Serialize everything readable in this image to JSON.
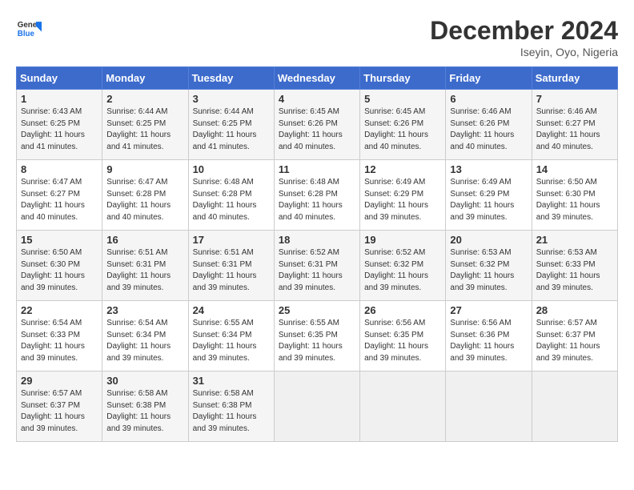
{
  "header": {
    "logo_line1": "General",
    "logo_line2": "Blue",
    "month_title": "December 2024",
    "location": "Iseyin, Oyo, Nigeria"
  },
  "days_of_week": [
    "Sunday",
    "Monday",
    "Tuesday",
    "Wednesday",
    "Thursday",
    "Friday",
    "Saturday"
  ],
  "weeks": [
    [
      {
        "day": "1",
        "sunrise": "6:43 AM",
        "sunset": "6:25 PM",
        "daylight": "11 hours and 41 minutes."
      },
      {
        "day": "2",
        "sunrise": "6:44 AM",
        "sunset": "6:25 PM",
        "daylight": "11 hours and 41 minutes."
      },
      {
        "day": "3",
        "sunrise": "6:44 AM",
        "sunset": "6:25 PM",
        "daylight": "11 hours and 41 minutes."
      },
      {
        "day": "4",
        "sunrise": "6:45 AM",
        "sunset": "6:26 PM",
        "daylight": "11 hours and 40 minutes."
      },
      {
        "day": "5",
        "sunrise": "6:45 AM",
        "sunset": "6:26 PM",
        "daylight": "11 hours and 40 minutes."
      },
      {
        "day": "6",
        "sunrise": "6:46 AM",
        "sunset": "6:26 PM",
        "daylight": "11 hours and 40 minutes."
      },
      {
        "day": "7",
        "sunrise": "6:46 AM",
        "sunset": "6:27 PM",
        "daylight": "11 hours and 40 minutes."
      }
    ],
    [
      {
        "day": "8",
        "sunrise": "6:47 AM",
        "sunset": "6:27 PM",
        "daylight": "11 hours and 40 minutes."
      },
      {
        "day": "9",
        "sunrise": "6:47 AM",
        "sunset": "6:28 PM",
        "daylight": "11 hours and 40 minutes."
      },
      {
        "day": "10",
        "sunrise": "6:48 AM",
        "sunset": "6:28 PM",
        "daylight": "11 hours and 40 minutes."
      },
      {
        "day": "11",
        "sunrise": "6:48 AM",
        "sunset": "6:28 PM",
        "daylight": "11 hours and 40 minutes."
      },
      {
        "day": "12",
        "sunrise": "6:49 AM",
        "sunset": "6:29 PM",
        "daylight": "11 hours and 39 minutes."
      },
      {
        "day": "13",
        "sunrise": "6:49 AM",
        "sunset": "6:29 PM",
        "daylight": "11 hours and 39 minutes."
      },
      {
        "day": "14",
        "sunrise": "6:50 AM",
        "sunset": "6:30 PM",
        "daylight": "11 hours and 39 minutes."
      }
    ],
    [
      {
        "day": "15",
        "sunrise": "6:50 AM",
        "sunset": "6:30 PM",
        "daylight": "11 hours and 39 minutes."
      },
      {
        "day": "16",
        "sunrise": "6:51 AM",
        "sunset": "6:31 PM",
        "daylight": "11 hours and 39 minutes."
      },
      {
        "day": "17",
        "sunrise": "6:51 AM",
        "sunset": "6:31 PM",
        "daylight": "11 hours and 39 minutes."
      },
      {
        "day": "18",
        "sunrise": "6:52 AM",
        "sunset": "6:31 PM",
        "daylight": "11 hours and 39 minutes."
      },
      {
        "day": "19",
        "sunrise": "6:52 AM",
        "sunset": "6:32 PM",
        "daylight": "11 hours and 39 minutes."
      },
      {
        "day": "20",
        "sunrise": "6:53 AM",
        "sunset": "6:32 PM",
        "daylight": "11 hours and 39 minutes."
      },
      {
        "day": "21",
        "sunrise": "6:53 AM",
        "sunset": "6:33 PM",
        "daylight": "11 hours and 39 minutes."
      }
    ],
    [
      {
        "day": "22",
        "sunrise": "6:54 AM",
        "sunset": "6:33 PM",
        "daylight": "11 hours and 39 minutes."
      },
      {
        "day": "23",
        "sunrise": "6:54 AM",
        "sunset": "6:34 PM",
        "daylight": "11 hours and 39 minutes."
      },
      {
        "day": "24",
        "sunrise": "6:55 AM",
        "sunset": "6:34 PM",
        "daylight": "11 hours and 39 minutes."
      },
      {
        "day": "25",
        "sunrise": "6:55 AM",
        "sunset": "6:35 PM",
        "daylight": "11 hours and 39 minutes."
      },
      {
        "day": "26",
        "sunrise": "6:56 AM",
        "sunset": "6:35 PM",
        "daylight": "11 hours and 39 minutes."
      },
      {
        "day": "27",
        "sunrise": "6:56 AM",
        "sunset": "6:36 PM",
        "daylight": "11 hours and 39 minutes."
      },
      {
        "day": "28",
        "sunrise": "6:57 AM",
        "sunset": "6:37 PM",
        "daylight": "11 hours and 39 minutes."
      }
    ],
    [
      {
        "day": "29",
        "sunrise": "6:57 AM",
        "sunset": "6:37 PM",
        "daylight": "11 hours and 39 minutes."
      },
      {
        "day": "30",
        "sunrise": "6:58 AM",
        "sunset": "6:38 PM",
        "daylight": "11 hours and 39 minutes."
      },
      {
        "day": "31",
        "sunrise": "6:58 AM",
        "sunset": "6:38 PM",
        "daylight": "11 hours and 39 minutes."
      },
      null,
      null,
      null,
      null
    ]
  ]
}
